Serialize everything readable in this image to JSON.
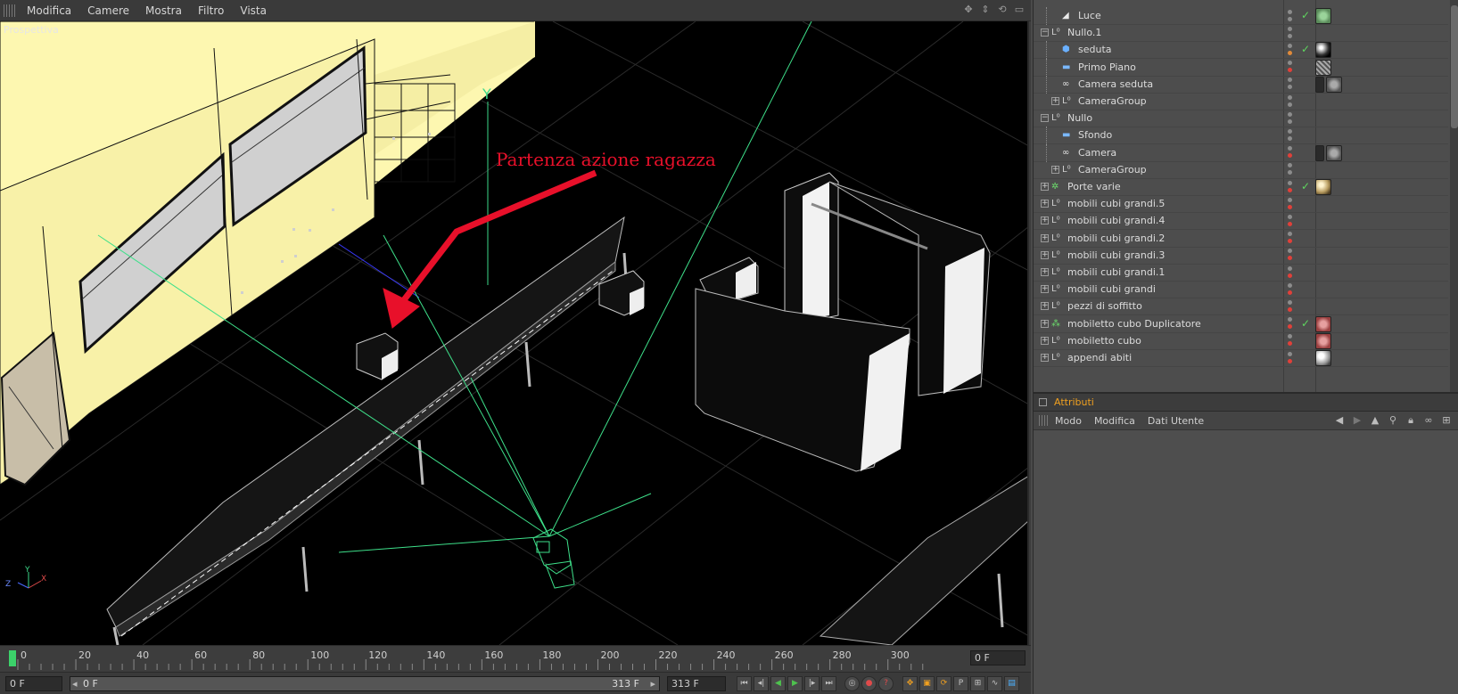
{
  "menubar": {
    "items": [
      "Modifica",
      "Camere",
      "Mostra",
      "Filtro",
      "Vista"
    ]
  },
  "viewport": {
    "label": "Prospettiva",
    "annotation": "Partenza azione ragazza",
    "axis_label": "Y",
    "gizmo_labels": {
      "y": "Y",
      "z": "Z",
      "x": "X"
    }
  },
  "timeline": {
    "ticks": [
      "0",
      "20",
      "40",
      "60",
      "80",
      "100",
      "120",
      "140",
      "160",
      "180",
      "200",
      "220",
      "240",
      "260",
      "280",
      "300"
    ],
    "current_frame": "0 F"
  },
  "transport": {
    "start_frame": "0 F",
    "range_start": "0 F",
    "range_end": "313 F",
    "end_frame": "313 F"
  },
  "object_manager": {
    "rows": [
      {
        "name": "Luce",
        "depth": 1,
        "expand": "",
        "icon": "light-icon",
        "dots": [
          "g",
          "g"
        ],
        "check": true,
        "tags": [
          "green-compositing"
        ]
      },
      {
        "name": "Nullo.1",
        "depth": 0,
        "expand": "−",
        "icon": "null-icon",
        "dots": [
          "g",
          "g"
        ],
        "check": false,
        "tags": []
      },
      {
        "name": "seduta",
        "depth": 1,
        "expand": "",
        "icon": "object-icon",
        "dots": [
          "g",
          "o"
        ],
        "check": true,
        "tags": [
          "black-material"
        ]
      },
      {
        "name": "Primo Piano",
        "depth": 1,
        "expand": "",
        "icon": "plane-icon",
        "dots": [
          "g",
          "r"
        ],
        "check": false,
        "tags": [
          "hatch"
        ]
      },
      {
        "name": "Camera seduta",
        "depth": 1,
        "expand": "",
        "icon": "camera-icon",
        "dots": [
          "g",
          "g"
        ],
        "check": false,
        "tags": [
          "protect",
          "gray-circle"
        ]
      },
      {
        "name": "CameraGroup",
        "depth": 1,
        "expand": "+",
        "icon": "null-icon",
        "dots": [
          "g",
          "g"
        ],
        "check": false,
        "tags": []
      },
      {
        "name": "Nullo",
        "depth": 0,
        "expand": "−",
        "icon": "null-icon",
        "dots": [
          "g",
          "g"
        ],
        "check": false,
        "tags": []
      },
      {
        "name": "Sfondo",
        "depth": 1,
        "expand": "",
        "icon": "background-icon",
        "dots": [
          "g",
          "g"
        ],
        "check": false,
        "tags": []
      },
      {
        "name": "Camera",
        "depth": 1,
        "expand": "",
        "icon": "camera-icon",
        "dots": [
          "g",
          "r"
        ],
        "check": false,
        "tags": [
          "protect",
          "gray-circle"
        ]
      },
      {
        "name": "CameraGroup",
        "depth": 1,
        "expand": "+",
        "icon": "null-icon",
        "dots": [
          "g",
          "g"
        ],
        "check": false,
        "tags": []
      },
      {
        "name": "Porte varie",
        "depth": 0,
        "expand": "+",
        "icon": "array-icon",
        "dots": [
          "g",
          "r"
        ],
        "check": true,
        "tags": [
          "tan-material"
        ]
      },
      {
        "name": "mobili cubi grandi.5",
        "depth": 0,
        "expand": "+",
        "icon": "null-icon",
        "dots": [
          "g",
          "r"
        ],
        "check": false,
        "tags": []
      },
      {
        "name": "mobili cubi grandi.4",
        "depth": 0,
        "expand": "+",
        "icon": "null-icon",
        "dots": [
          "g",
          "r"
        ],
        "check": false,
        "tags": []
      },
      {
        "name": "mobili cubi grandi.2",
        "depth": 0,
        "expand": "+",
        "icon": "null-icon",
        "dots": [
          "g",
          "r"
        ],
        "check": false,
        "tags": []
      },
      {
        "name": "mobili cubi grandi.3",
        "depth": 0,
        "expand": "+",
        "icon": "null-icon",
        "dots": [
          "g",
          "r"
        ],
        "check": false,
        "tags": []
      },
      {
        "name": "mobili cubi grandi.1",
        "depth": 0,
        "expand": "+",
        "icon": "null-icon",
        "dots": [
          "g",
          "r"
        ],
        "check": false,
        "tags": []
      },
      {
        "name": "mobili cubi grandi",
        "depth": 0,
        "expand": "+",
        "icon": "null-icon",
        "dots": [
          "g",
          "r"
        ],
        "check": false,
        "tags": []
      },
      {
        "name": "pezzi di soffitto",
        "depth": 0,
        "expand": "+",
        "icon": "null-icon",
        "dots": [
          "g",
          "r"
        ],
        "check": false,
        "tags": []
      },
      {
        "name": "mobiletto cubo Duplicatore",
        "depth": 0,
        "expand": "+",
        "icon": "cloner-icon",
        "dots": [
          "g",
          "r"
        ],
        "check": true,
        "tags": [
          "red-compositing"
        ]
      },
      {
        "name": "mobiletto cubo",
        "depth": 0,
        "expand": "+",
        "icon": "null-icon",
        "dots": [
          "g",
          "r"
        ],
        "check": false,
        "tags": [
          "red-compositing"
        ]
      },
      {
        "name": "appendi abiti",
        "depth": 0,
        "expand": "+",
        "icon": "null-icon",
        "dots": [
          "g",
          "r"
        ],
        "check": false,
        "tags": [
          "white-material"
        ]
      }
    ]
  },
  "attributes": {
    "title": "Attributi",
    "menu": [
      "Modo",
      "Modifica",
      "Dati Utente"
    ]
  },
  "colors": {
    "accent": "#f0a020",
    "annotation": "#e8102a",
    "wire": "#4fe08a",
    "wall": "#fdf7b0"
  }
}
